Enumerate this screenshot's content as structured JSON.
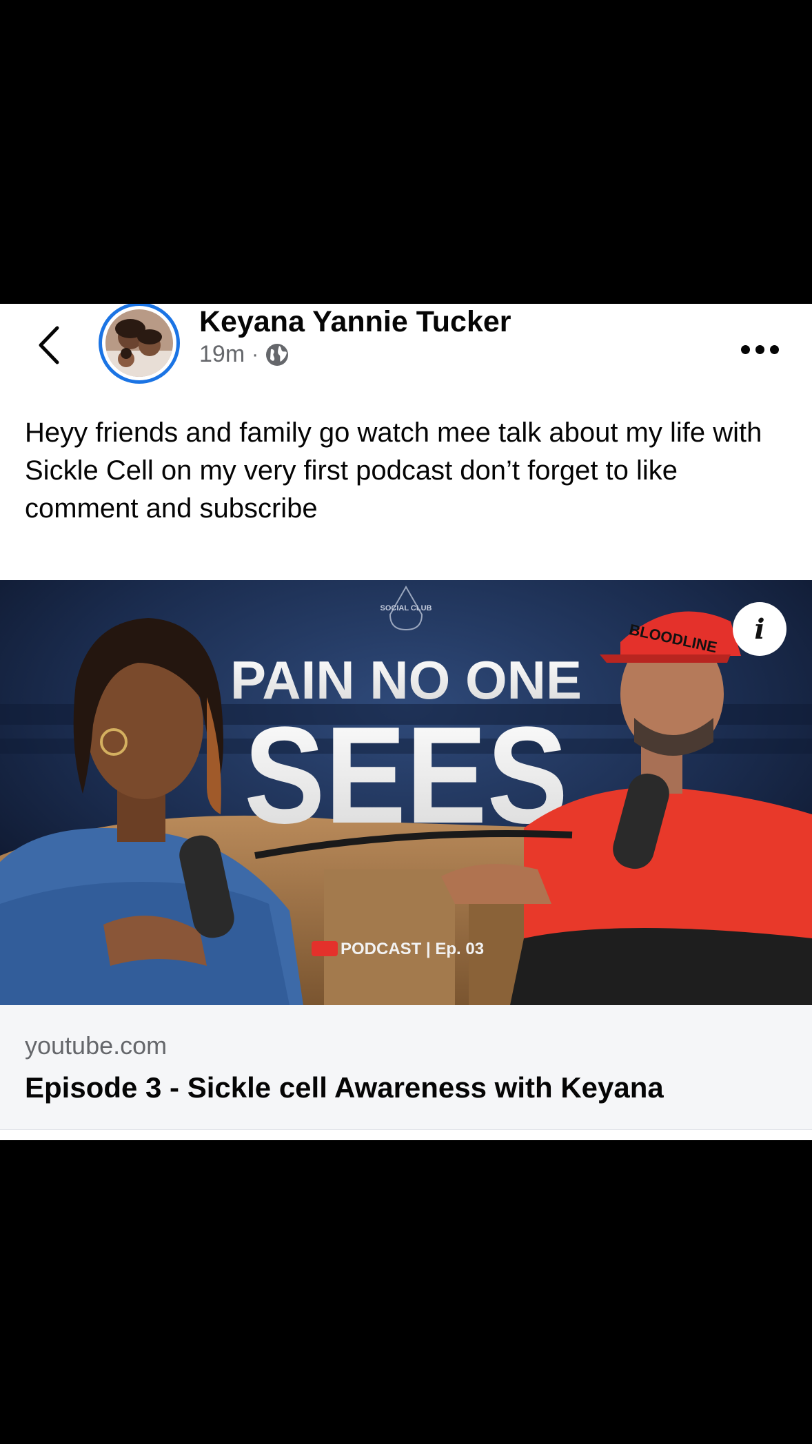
{
  "post": {
    "author_name": "Keyana Yannie Tucker",
    "time": "19m",
    "separator": "·",
    "privacy_icon": "globe-icon",
    "back_icon": "chevron-left-icon",
    "more_icon": "more-horizontal-icon",
    "text": "Heyy friends and family go watch mee talk about my life with Sickle Cell on my very first podcast don’t forget to like comment and subscribe"
  },
  "link_preview": {
    "thumbnail": {
      "logo_text": "SOCIAL CLUB",
      "headline_line1": "PAIN NO ONE",
      "headline_line2": "SEES",
      "cap_text": "BLOODLINE",
      "badge_text": "PODCAST | Ep. 03",
      "info_label": "i"
    },
    "domain": "youtube.com",
    "title": "Episode 3 - Sickle cell Awareness with Keyana"
  },
  "colors": {
    "accent_ring": "#1b74e4",
    "text_primary": "#050505",
    "text_secondary": "#65676b",
    "link_box_bg": "#f5f6f8"
  }
}
